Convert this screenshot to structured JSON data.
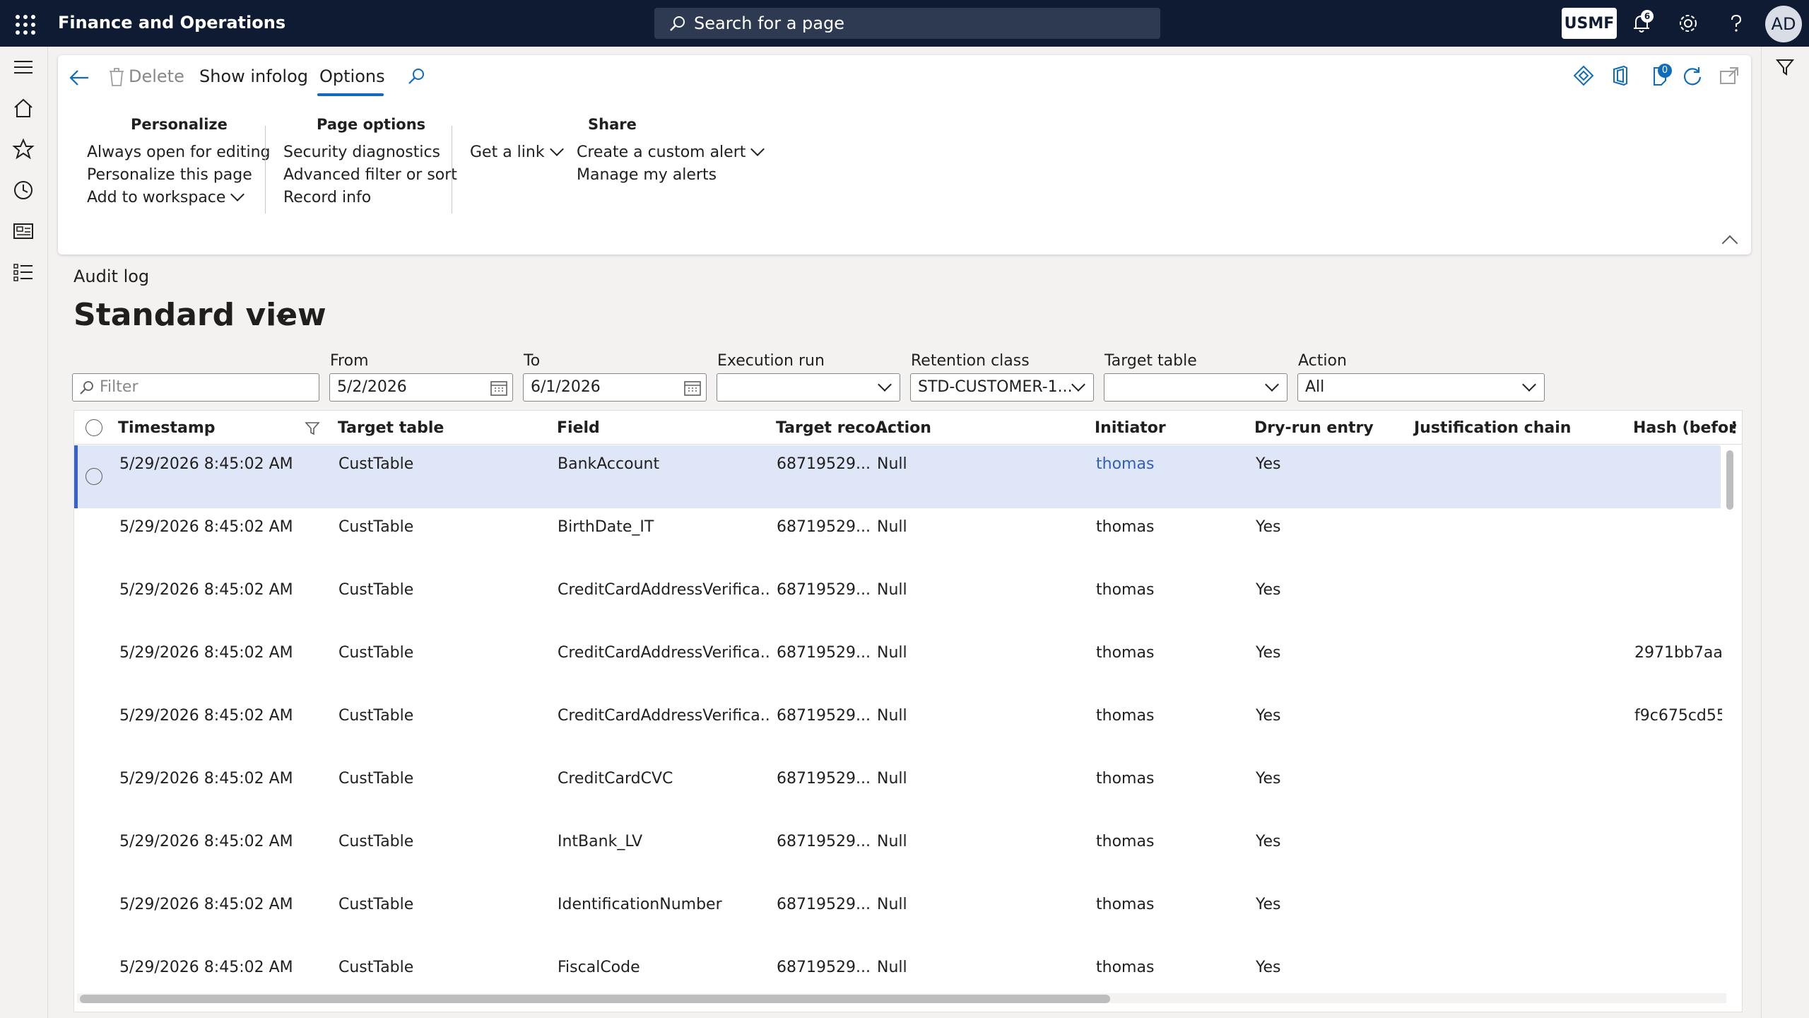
{
  "topbar": {
    "app_title": "Finance and Operations",
    "search_placeholder": "Search for a page",
    "company": "USMF",
    "notification_count": "6",
    "avatar_initials": "AD",
    "icons": [
      "waffle-icon",
      "search-icon",
      "bell-icon",
      "gear-icon",
      "help-icon"
    ]
  },
  "leftrail": {
    "icons": [
      "hamburger-icon",
      "home-icon",
      "star-icon",
      "clock-icon",
      "workspace-icon",
      "list-icon"
    ]
  },
  "actionpane": {
    "back_icon": "back-arrow-icon",
    "delete_label": "Delete",
    "show_infolog_label": "Show infolog",
    "options_tab_label": "Options",
    "find_icon": "search-icon",
    "groups": {
      "personalize": {
        "title": "Personalize",
        "items": [
          "Always open for editing",
          "Personalize this page",
          "Add to workspace"
        ]
      },
      "page_options": {
        "title": "Page options",
        "items": [
          "Security diagnostics",
          "Advanced filter or sort",
          "Record info"
        ]
      },
      "get_link": {
        "label": "Get a link"
      },
      "share": {
        "title": "Share",
        "items": [
          "Create a custom alert",
          "Manage my alerts"
        ]
      }
    },
    "right_icons": [
      "diamond-icon",
      "office-icon",
      "attachment-icon",
      "refresh-icon",
      "open-new-window-icon"
    ],
    "attachment_count": "0"
  },
  "header": {
    "caption": "Audit log",
    "view_title": "Standard view"
  },
  "filters": {
    "filter_placeholder": "Filter",
    "from_label": "From",
    "from_value": "5/2/2026",
    "to_label": "To",
    "to_value": "6/1/2026",
    "execution_run_label": "Execution run",
    "execution_run_value": "",
    "retention_class_label": "Retention class",
    "retention_class_value": "STD-CUSTOMER-1...",
    "target_table_label": "Target table",
    "target_table_value": "",
    "action_label": "Action",
    "action_value": "All"
  },
  "grid": {
    "columns": [
      "Timestamp",
      "Target table",
      "Field",
      "Target reco...",
      "Action",
      "Initiator",
      "Dry-run entry",
      "Justification chain",
      "Hash (befor"
    ],
    "rows": [
      {
        "timestamp": "5/29/2026 8:45:02 AM",
        "target_table": "CustTable",
        "field": "BankAccount",
        "target_record": "68719529...",
        "action": "Null",
        "initiator": "thomas",
        "dry_run": "Yes",
        "justification": "",
        "hash": "",
        "selected": true
      },
      {
        "timestamp": "5/29/2026 8:45:02 AM",
        "target_table": "CustTable",
        "field": "BirthDate_IT",
        "target_record": "68719529...",
        "action": "Null",
        "initiator": "thomas",
        "dry_run": "Yes",
        "justification": "",
        "hash": ""
      },
      {
        "timestamp": "5/29/2026 8:45:02 AM",
        "target_table": "CustTable",
        "field": "CreditCardAddressVerifica...",
        "target_record": "68719529...",
        "action": "Null",
        "initiator": "thomas",
        "dry_run": "Yes",
        "justification": "",
        "hash": ""
      },
      {
        "timestamp": "5/29/2026 8:45:02 AM",
        "target_table": "CustTable",
        "field": "CreditCardAddressVerifica...",
        "target_record": "68719529...",
        "action": "Null",
        "initiator": "thomas",
        "dry_run": "Yes",
        "justification": "",
        "hash": "2971bb7aa"
      },
      {
        "timestamp": "5/29/2026 8:45:02 AM",
        "target_table": "CustTable",
        "field": "CreditCardAddressVerifica...",
        "target_record": "68719529...",
        "action": "Null",
        "initiator": "thomas",
        "dry_run": "Yes",
        "justification": "",
        "hash": "f9c675cd55"
      },
      {
        "timestamp": "5/29/2026 8:45:02 AM",
        "target_table": "CustTable",
        "field": "CreditCardCVC",
        "target_record": "68719529...",
        "action": "Null",
        "initiator": "thomas",
        "dry_run": "Yes",
        "justification": "",
        "hash": ""
      },
      {
        "timestamp": "5/29/2026 8:45:02 AM",
        "target_table": "CustTable",
        "field": "IntBank_LV",
        "target_record": "68719529...",
        "action": "Null",
        "initiator": "thomas",
        "dry_run": "Yes",
        "justification": "",
        "hash": ""
      },
      {
        "timestamp": "5/29/2026 8:45:02 AM",
        "target_table": "CustTable",
        "field": "IdentificationNumber",
        "target_record": "68719529...",
        "action": "Null",
        "initiator": "thomas",
        "dry_run": "Yes",
        "justification": "",
        "hash": ""
      },
      {
        "timestamp": "5/29/2026 8:45:02 AM",
        "target_table": "CustTable",
        "field": "FiscalCode",
        "target_record": "68719529...",
        "action": "Null",
        "initiator": "thomas",
        "dry_run": "Yes",
        "justification": "",
        "hash": ""
      }
    ]
  },
  "colors": {
    "topbar": "#0f1b33",
    "accent": "#0f6cbd",
    "selected_row": "#dfe6f7",
    "selected_bar": "#3861d0",
    "link": "#2f5fbf"
  }
}
